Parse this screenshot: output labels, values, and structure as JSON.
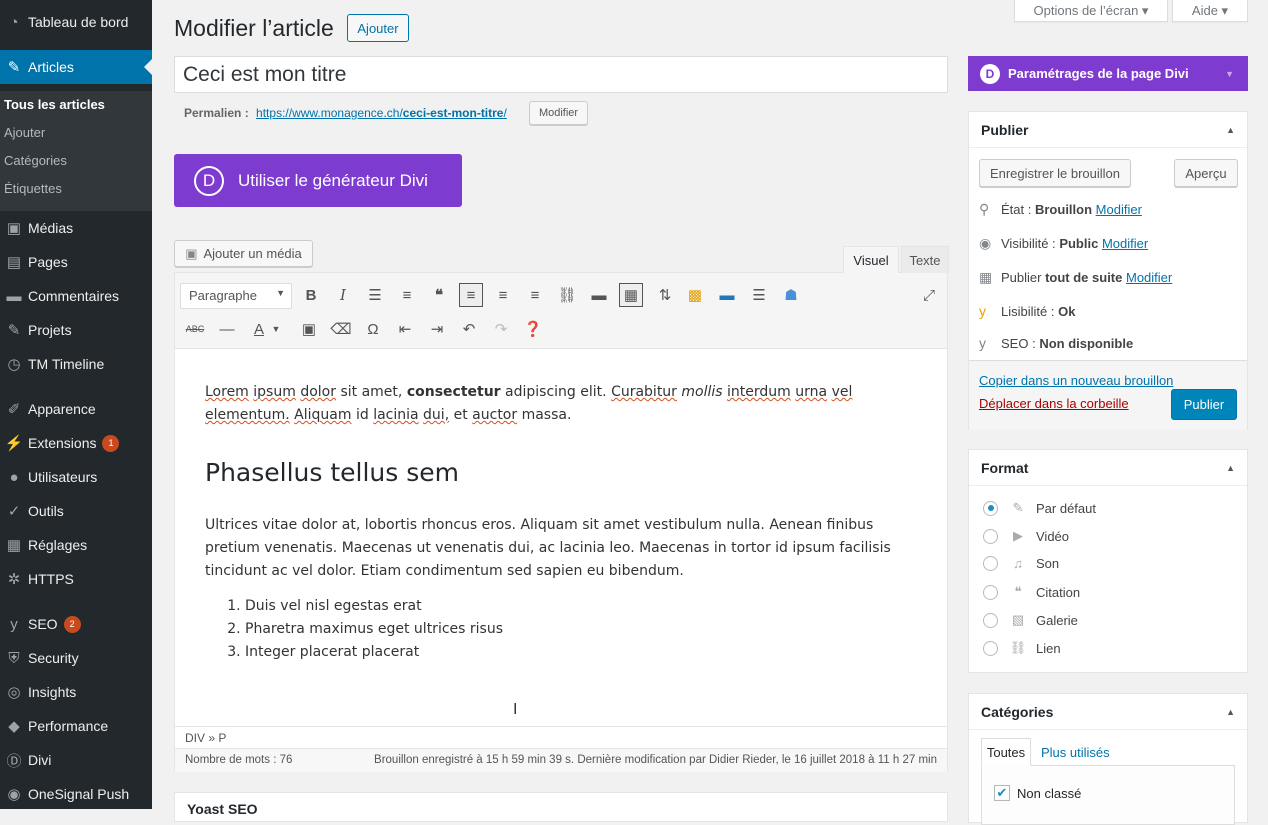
{
  "sidebar": {
    "items": [
      {
        "label": "Tableau de bord",
        "icon": "dashboard-icon"
      },
      {
        "label": "Articles",
        "icon": "pin-icon"
      },
      {
        "label": "Médias",
        "icon": "media-icon"
      },
      {
        "label": "Pages",
        "icon": "pages-icon"
      },
      {
        "label": "Commentaires",
        "icon": "comments-icon"
      },
      {
        "label": "Projets",
        "icon": "pin-icon"
      },
      {
        "label": "TM Timeline",
        "icon": "clock-icon"
      },
      {
        "label": "Apparence",
        "icon": "brush-icon"
      },
      {
        "label": "Extensions",
        "icon": "plugin-icon",
        "badge": "1"
      },
      {
        "label": "Utilisateurs",
        "icon": "users-icon"
      },
      {
        "label": "Outils",
        "icon": "wrench-icon"
      },
      {
        "label": "Réglages",
        "icon": "settings-icon"
      },
      {
        "label": "HTTPS",
        "icon": "gear-icon"
      },
      {
        "label": "SEO",
        "icon": "yoast-icon",
        "badge": "2"
      },
      {
        "label": "Security",
        "icon": "shield-icon"
      },
      {
        "label": "Insights",
        "icon": "insights-icon"
      },
      {
        "label": "Performance",
        "icon": "performance-icon"
      },
      {
        "label": "Divi",
        "icon": "divi-icon"
      },
      {
        "label": "OneSignal Push",
        "icon": "onesignal-icon"
      }
    ],
    "submenu": [
      "Tous les articles",
      "Ajouter",
      "Catégories",
      "Étiquettes"
    ]
  },
  "top": {
    "screen_options": "Options de l’écran ▾",
    "help": "Aide ▾"
  },
  "page": {
    "title": "Modifier l’article",
    "add": "Ajouter"
  },
  "post": {
    "title": "Ceci est mon titre",
    "permalink_label": "Permalien :",
    "permalink_prefix": "https://www.monagence.ch/",
    "permalink_slug": "ceci-est-mon-titre",
    "permalink_suffix": "/",
    "permalink_edit": "Modifier"
  },
  "divi": {
    "builder_btn": "Utiliser le générateur Divi",
    "logo": "D",
    "settings": "Paramétrages de la page Divi"
  },
  "editor": {
    "add_media": "Ajouter un média",
    "tab_visual": "Visuel",
    "tab_text": "Texte",
    "format": "Paragraphe",
    "p1": {
      "a": "Lorem",
      "b": "ipsum",
      "c": "dolor",
      "d": "sit amet,",
      "e": "consectetur",
      "f": "adipiscing",
      "g": "elit.",
      "h": "Curabitur",
      "i": "mollis",
      "j": "interdum",
      "k": "urna",
      "l": "vel",
      "m": "elementum.",
      "n": "Aliquam",
      "o": "id",
      "p": "lacinia",
      "q": "dui,",
      "r": "et",
      "s": "auctor",
      "t": "massa."
    },
    "heading": "Phasellus tellus sem",
    "p2": "Ultrices vitae dolor at, lobortis rhoncus eros. Aliquam sit amet vestibulum nulla. Aenean finibus pretium venenatis. Maecenas ut venenatis dui, ac lacinia leo. Maecenas in tortor id ipsum facilisis tincidunt ac vel dolor. Etiam condimentum sed sapien eu bibendum.",
    "list": [
      "Duis vel nisl egestas erat",
      "Pharetra maximus eget ultrices risus",
      "Integer placerat placerat"
    ],
    "path": "DIV » P",
    "word_count": "Nombre de mots : 76",
    "saved": "Brouillon enregistré à 15 h 59 min 39 s. Dernière modification par Didier Rieder, le 16 juillet 2018 à 11 h 27 min"
  },
  "yoast": {
    "title": "Yoast SEO"
  },
  "publish": {
    "title": "Publier",
    "save_draft": "Enregistrer le brouillon",
    "preview": "Aperçu",
    "status_label": "État :",
    "status_value": "Brouillon",
    "visibility_label": "Visibilité :",
    "visibility_value": "Public",
    "publish_label": "Publier",
    "publish_value": "tout de suite",
    "readability_label": "Lisibilité :",
    "readability_value": "Ok",
    "seo_label": "SEO :",
    "seo_value": "Non disponible",
    "edit": "Modifier",
    "copy_draft": "Copier dans un nouveau brouillon",
    "trash": "Déplacer dans la corbeille",
    "publish_btn": "Publier"
  },
  "format": {
    "title": "Format",
    "options": [
      "Par défaut",
      "Vidéo",
      "Son",
      "Citation",
      "Galerie",
      "Lien"
    ],
    "selected": "Par défaut"
  },
  "categories": {
    "title": "Catégories",
    "tab_all": "Toutes",
    "tab_popular": "Plus utilisés",
    "items": [
      "Non classé"
    ]
  },
  "colors": {
    "sidebar": "#23282d",
    "accent": "#0073aa",
    "divi": "#7e3bd0"
  }
}
